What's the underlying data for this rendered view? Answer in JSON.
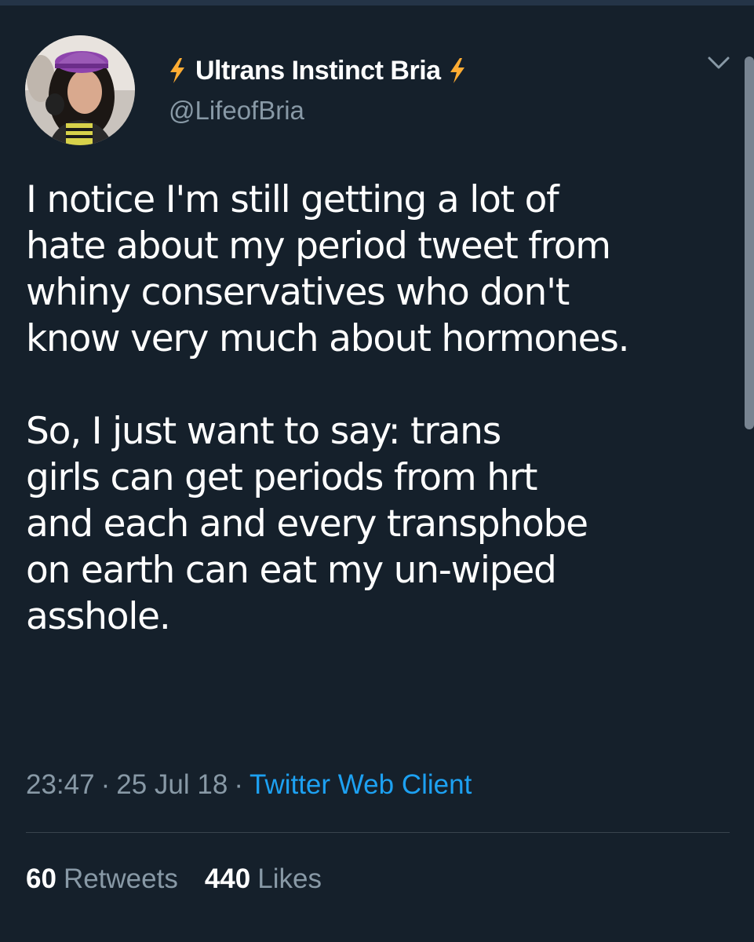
{
  "profile": {
    "display_name": "Ultrans Instinct Bria",
    "handle": "@LifeofBria",
    "left_emoji": "lightning-bolt-icon",
    "right_emoji": "lightning-bolt-icon",
    "avatar": "profile-photo"
  },
  "tweet": {
    "text": "I notice I'm still getting a lot of\nhate about my period tweet from\nwhiny conservatives who don't\nknow very much about hormones.\n\nSo, I just want to say: trans\ngirls can get periods from hrt\nand each and every transphobe\non earth can eat my un-wiped\nasshole."
  },
  "meta": {
    "time": "23:47",
    "separator": "·",
    "date": "25 Jul 18",
    "source": "Twitter Web Client"
  },
  "stats": {
    "retweets_count": "60",
    "retweets_label": "Retweets",
    "likes_count": "440",
    "likes_label": "Likes"
  },
  "colors": {
    "background": "#15202b",
    "text_primary": "#ffffff",
    "text_secondary": "#8899a6",
    "link": "#1da1f2",
    "bolt": "#ffac33",
    "divider": "#38444d"
  },
  "icons": {
    "caret": "chevron-down-icon"
  }
}
